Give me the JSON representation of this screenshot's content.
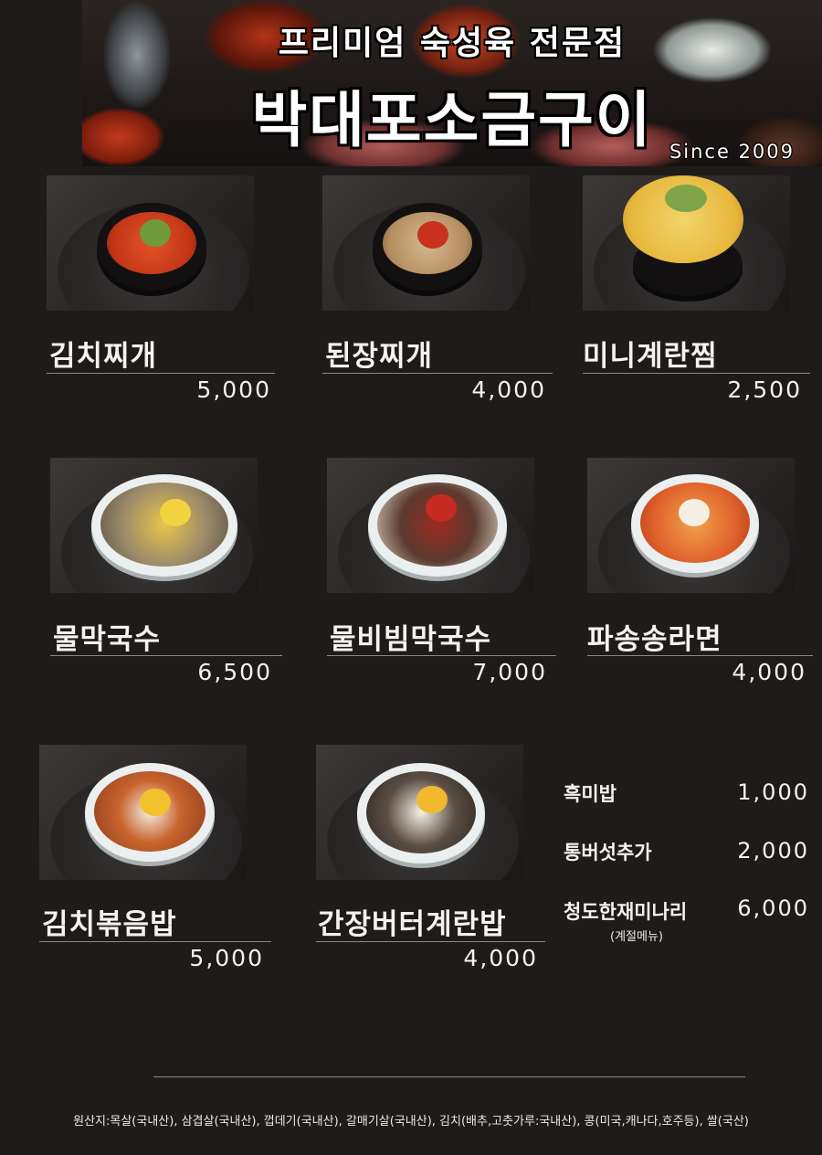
{
  "header": {
    "subtitle": "프리미엄 숙성육 전문점",
    "title": "박대포소금구이",
    "since": "Since 2009"
  },
  "menu": [
    {
      "name": "김치찌개",
      "price": "5,000"
    },
    {
      "name": "된장찌개",
      "price": "4,000"
    },
    {
      "name": "미니계란찜",
      "price": "2,500"
    },
    {
      "name": "물막국수",
      "price": "6,500"
    },
    {
      "name": "물비빔막국수",
      "price": "7,000"
    },
    {
      "name": "파송송라면",
      "price": "4,000"
    },
    {
      "name": "김치볶음밥",
      "price": "5,000"
    },
    {
      "name": "간장버터계란밥",
      "price": "4,000"
    }
  ],
  "extras": [
    {
      "name": "흑미밥",
      "price": "1,000"
    },
    {
      "name": "통버섯추가",
      "price": "2,000"
    },
    {
      "name": "청도한재미나리",
      "price": "6,000",
      "note": "(계절메뉴)"
    }
  ],
  "origin": "원산지:목살(국내산), 삼겹살(국내산), 껍데기(국내산), 갈매기살(국내산), 김치(배추,고춧가루:국내산), 콩(미국,캐나다,호주등), 쌀(국산)"
}
